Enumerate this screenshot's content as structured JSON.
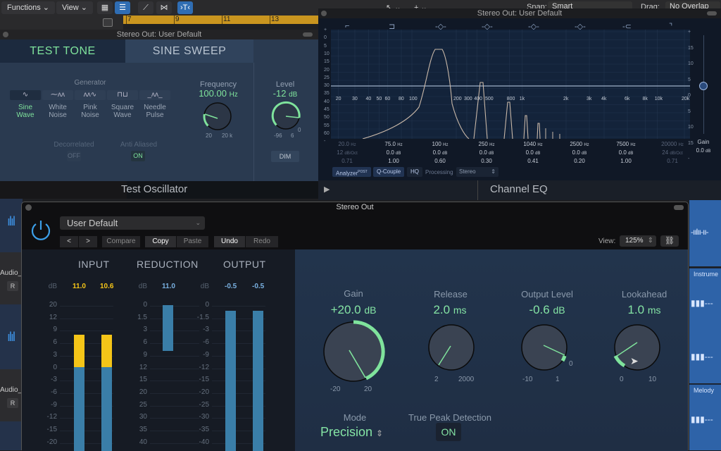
{
  "toolbar": {
    "functions_label": "Functions",
    "view_label": "View",
    "snap_label": "Snap:",
    "snap_value": "Smart",
    "drag_label": "Drag:",
    "drag_value": "No Overlap",
    "ruler_marks": [
      "7",
      "9",
      "11",
      "13"
    ]
  },
  "left_tracks": [
    {
      "name": "Audio_",
      "r_button": "R"
    },
    {
      "name": "Audio_",
      "r_button": "R"
    }
  ],
  "right_tracks": [
    {
      "name": "Instrume"
    },
    {
      "name": "Melody"
    }
  ],
  "test_oscillator": {
    "window_title": "Stereo Out: User Default",
    "tabs": [
      {
        "label": "TEST TONE",
        "active": true
      },
      {
        "label": "SINE SWEEP",
        "active": false
      }
    ],
    "generator_label": "Generator",
    "generators": [
      {
        "line1": "Sine",
        "line2": "Wave",
        "selected": true
      },
      {
        "line1": "White",
        "line2": "Noise",
        "selected": false
      },
      {
        "line1": "Pink",
        "line2": "Noise",
        "selected": false
      },
      {
        "line1": "Square",
        "line2": "Wave",
        "selected": false
      },
      {
        "line1": "Needle",
        "line2": "Pulse",
        "selected": false
      }
    ],
    "frequency": {
      "label": "Frequency",
      "value": "100.00",
      "unit": "Hz",
      "min": "20",
      "max": "20 k"
    },
    "level": {
      "label": "Level",
      "value": "-12",
      "unit": "dB",
      "min": "-96",
      "max": "6",
      "zero_mark": "0"
    },
    "decorrelated": {
      "label": "Decorrelated",
      "value": "OFF"
    },
    "anti_aliased": {
      "label": "Anti Aliased",
      "value": "ON"
    },
    "dim_label": "DIM",
    "plugin_name": "Test Oscillator"
  },
  "channel_eq": {
    "window_title": "Stereo Out: User Default",
    "db_scale": [
      "+",
      "0",
      "5",
      "10",
      "15",
      "20",
      "25",
      "30",
      "35",
      "40",
      "45",
      "50",
      "55",
      "60",
      "-"
    ],
    "right_db_scale": [
      "+",
      "15",
      "10",
      "5",
      "0",
      "5",
      "10",
      "15",
      "-"
    ],
    "freq_labels": [
      "20",
      "30",
      "40",
      "50",
      "60",
      "80",
      "100",
      "200",
      "300",
      "400",
      "500",
      "800",
      "1k",
      "2k",
      "3k",
      "4k",
      "6k",
      "8k",
      "10k",
      "20k"
    ],
    "bands": [
      {
        "freq": "20.0",
        "unit": "Hz",
        "gain": "12",
        "gain_unit": "dB/Oct",
        "q": "0.71",
        "dim": true
      },
      {
        "freq": "75.0",
        "unit": "Hz",
        "gain": "0.0",
        "gain_unit": "dB",
        "q": "1.00",
        "dim": false
      },
      {
        "freq": "100",
        "unit": "Hz",
        "gain": "0.0",
        "gain_unit": "dB",
        "q": "0.60",
        "dim": false
      },
      {
        "freq": "250",
        "unit": "Hz",
        "gain": "0.0",
        "gain_unit": "dB",
        "q": "0.30",
        "dim": false
      },
      {
        "freq": "1040",
        "unit": "Hz",
        "gain": "0.0",
        "gain_unit": "dB",
        "q": "0.41",
        "dim": false
      },
      {
        "freq": "2500",
        "unit": "Hz",
        "gain": "0.0",
        "gain_unit": "dB",
        "q": "0.20",
        "dim": false
      },
      {
        "freq": "7500",
        "unit": "Hz",
        "gain": "0.0",
        "gain_unit": "dB",
        "q": "1.00",
        "dim": false
      },
      {
        "freq": "20000",
        "unit": "Hz",
        "gain": "24",
        "gain_unit": "dB/Oct",
        "q": "0.71",
        "dim": true
      }
    ],
    "gain": {
      "label": "Gain",
      "value": "0.0",
      "unit": "dB"
    },
    "analyzer_label": "Analyzer",
    "analyzer_sup": "POST",
    "q_couple_label": "Q-Couple",
    "hq_label": "HQ",
    "processing_label": "Processing",
    "processing_value": "Stereo",
    "plugin_name": "Channel EQ"
  },
  "limiter": {
    "window_title": "Stereo Out",
    "preset": "User Default",
    "nav_prev": "<",
    "nav_next": ">",
    "compare_label": "Compare",
    "copy_label": "Copy",
    "paste_label": "Paste",
    "undo_label": "Undo",
    "redo_label": "Redo",
    "view_label": "View:",
    "view_value": "125%",
    "meters": {
      "input": {
        "label": "INPUT",
        "unit": "dB",
        "values": [
          "11.0",
          "10.6"
        ],
        "scale": [
          "20",
          "12",
          "9",
          "6",
          "3",
          "0",
          "-3",
          "-6",
          "-9",
          "-12",
          "-15",
          "-20"
        ]
      },
      "reduction": {
        "label": "REDUCTION",
        "unit": "dB",
        "values": [
          "11.0"
        ],
        "scale": [
          "0",
          "1.5",
          "3",
          "6",
          "9",
          "12",
          "15",
          "20",
          "25",
          "30",
          "35",
          "40"
        ]
      },
      "output": {
        "label": "OUTPUT",
        "unit": "dB",
        "values": [
          "-0.5",
          "-0.5"
        ],
        "scale": [
          "0",
          "-1.5",
          "-3",
          "-6",
          "-9",
          "-12",
          "-15",
          "-20",
          "-25",
          "-30",
          "-35",
          "-40"
        ]
      }
    },
    "knobs": [
      {
        "label": "Gain",
        "value": "+20.0",
        "unit": "dB",
        "min": "-20",
        "max": "20",
        "fraction": 1.0
      },
      {
        "label": "Release",
        "value": "2.0",
        "unit": "ms",
        "min": "2",
        "max": "2000",
        "fraction": 0.0
      },
      {
        "label": "Output Level",
        "value": "-0.6",
        "unit": "dB",
        "min": "-10",
        "max": "1",
        "zero_mark": "0",
        "fraction": 0.86
      },
      {
        "label": "Lookahead",
        "value": "1.0",
        "unit": "ms",
        "min": "0",
        "max": "10",
        "fraction": 0.1
      }
    ],
    "mode": {
      "label": "Mode",
      "value": "Precision"
    },
    "true_peak": {
      "label": "True Peak Detection",
      "value": "ON"
    }
  },
  "colors": {
    "accent_green": "#7fe39c",
    "input_yellow": "#f5c518",
    "meter_blue": "#3a7ea8",
    "ruler_gold": "#c9951f"
  }
}
